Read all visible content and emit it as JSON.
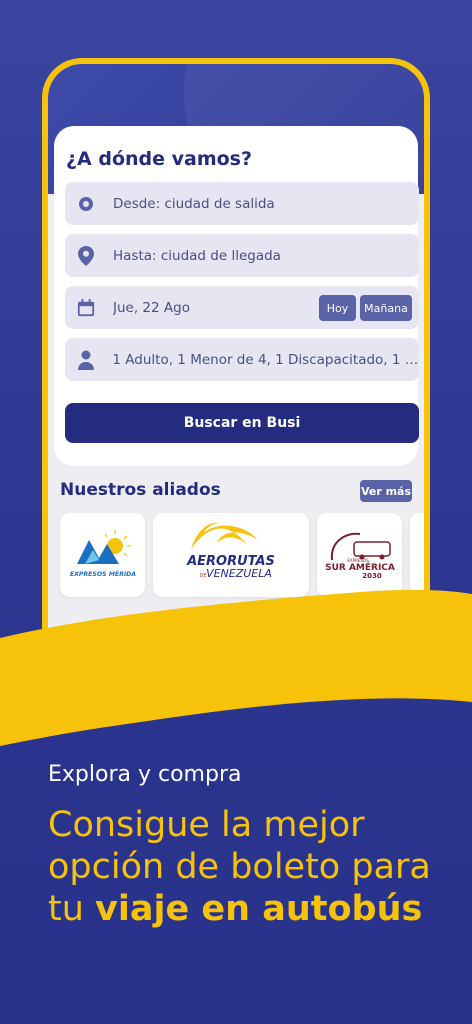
{
  "search": {
    "title": "¿A dónde vamos?",
    "from_placeholder": "Desde: ciudad de salida",
    "to_placeholder": "Hasta: ciudad de llegada",
    "date_value": "Jue, 22 Ago",
    "chip_today": "Hoy",
    "chip_tomorrow": "Mañana",
    "passengers_value": "1 Adulto, 1 Menor de 4, 1 Discapacitado, 1 M...",
    "button_label": "Buscar en Busi"
  },
  "allies": {
    "title": "Nuestros aliados",
    "see_more": "Ver más",
    "logos": [
      {
        "name": "EXPRESOS MÉRIDA"
      },
      {
        "name_line1": "AERORUTAS",
        "name_line2": "DE",
        "name_line3": "VENEZUELA"
      },
      {
        "name_line1": "EXPRESOS",
        "name_line2": "SUR AMÉRICA",
        "name_line3": "2030"
      }
    ]
  },
  "promo": {
    "subtitle": "Explora y compra",
    "headline_part1": "Consigue la mejor",
    "headline_part2": "opción de boleto para",
    "headline_part3": "tu ",
    "headline_bold": "viaje en autobús"
  },
  "colors": {
    "navy": "#232c7e",
    "yellow": "#f7c20a",
    "chip": "#5b63a8",
    "field_bg": "#e5e6f1"
  }
}
